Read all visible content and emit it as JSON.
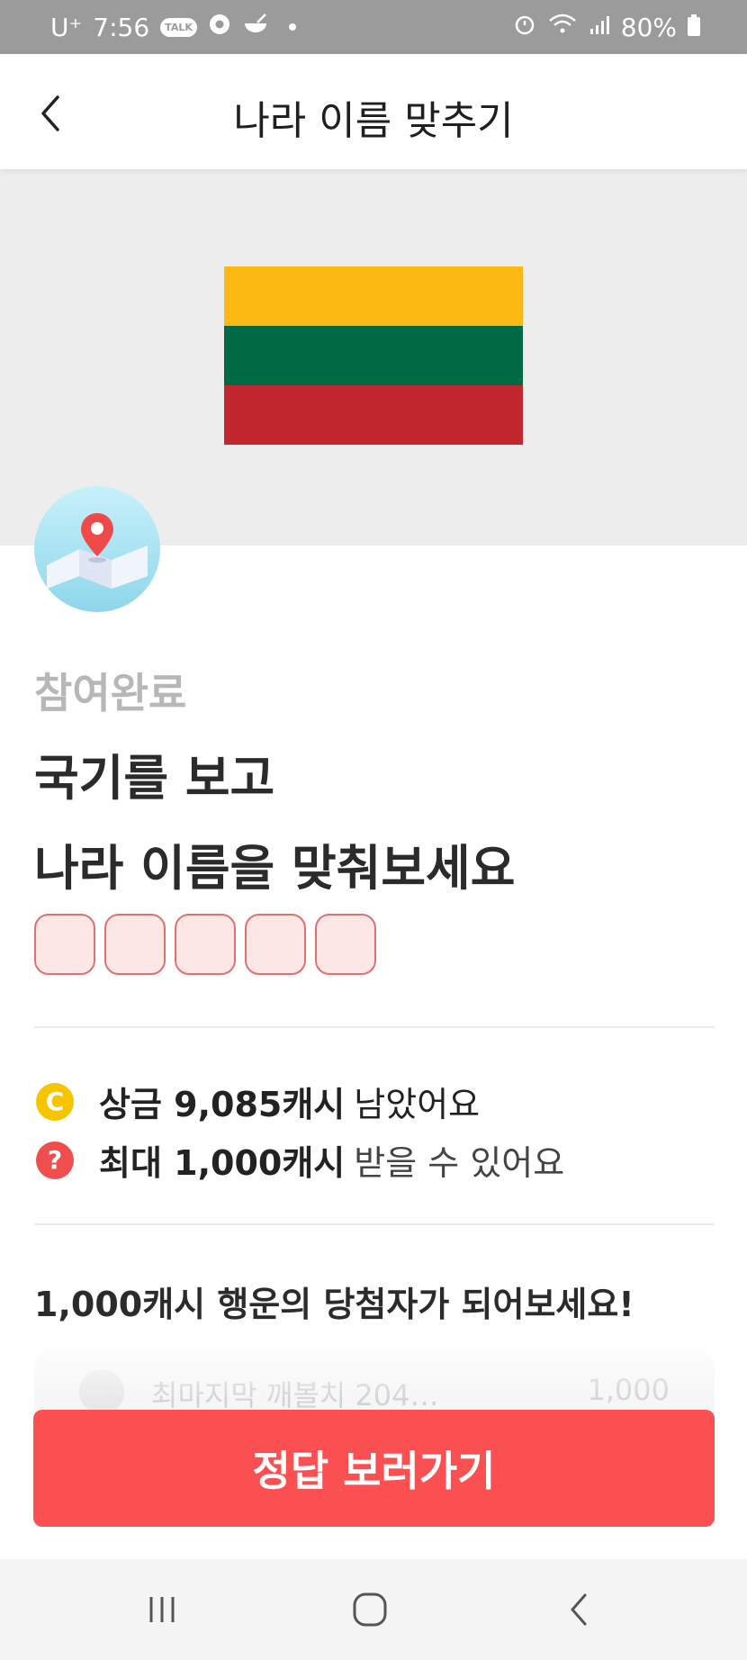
{
  "status_bar": {
    "carrier": "U⁺",
    "time": "7:56",
    "talk_badge": "TALK",
    "battery": "80%",
    "icons": [
      "chat-icon",
      "chrome-icon",
      "bowl-icon",
      "dot-icon",
      "alarm-icon",
      "wifi-icon",
      "signal-icon",
      "battery-icon"
    ]
  },
  "header": {
    "title": "나라 이름 맞추기",
    "back_icon": "chevron-left-icon"
  },
  "quiz": {
    "flag_colors": [
      "#FDB913",
      "#006A44",
      "#C1272D"
    ],
    "badge_icon": "map-pin-icon",
    "status": "참여완료",
    "headline_line1": "국기를 보고",
    "headline_line2": "나라 이름을 맞춰보세요",
    "answer_slot_count": 5
  },
  "info": {
    "prize_icon": "coin-icon",
    "prize_bold": "상금 9,085캐시",
    "prize_rest": "남았어요",
    "max_icon": "question-icon",
    "max_bold": "최대 1,000캐시",
    "max_rest": "받을 수 있어요"
  },
  "lucky": {
    "heading": "1,000캐시 행운의 당첨자가 되어보세요!",
    "winner_text": "최마지막 깨볼치 204…",
    "winner_amount": "1,000"
  },
  "cta": {
    "label": "정답 보러가기"
  },
  "nav": {
    "icons": [
      "recent-apps-icon",
      "home-icon",
      "back-icon"
    ]
  },
  "colors": {
    "accent": "#FB5051",
    "muted": "#B7B7B7",
    "coin": "#F7C400",
    "question": "#F04E4E"
  }
}
